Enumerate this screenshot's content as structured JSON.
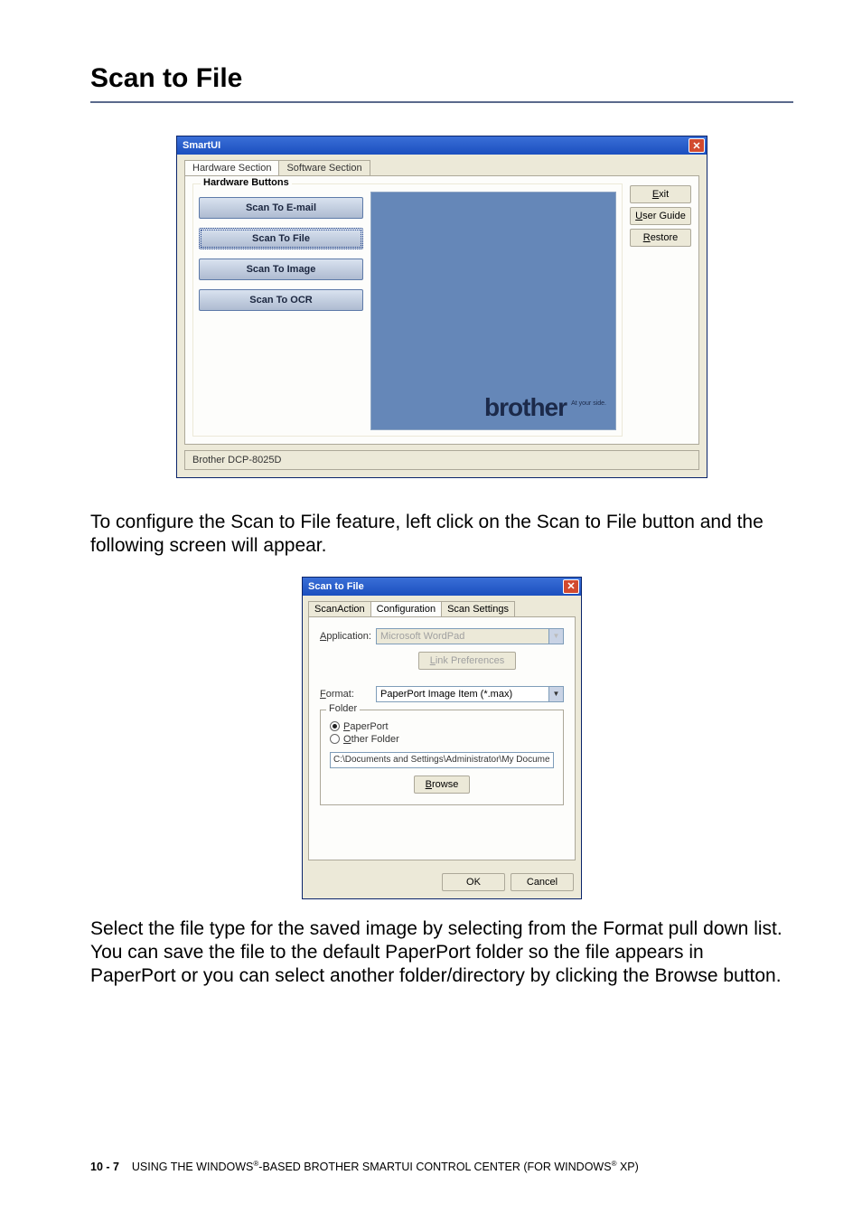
{
  "section_title": "Scan to File",
  "smartui": {
    "title": "SmartUI",
    "tabs": [
      "Hardware Section",
      "Software Section"
    ],
    "group_label": "Hardware Buttons",
    "buttons": [
      "Scan To E-mail",
      "Scan To File",
      "Scan To Image",
      "Scan To OCR"
    ],
    "side": {
      "exit": "Exit",
      "guide": "User Guide",
      "restore": "Restore"
    },
    "logo": "brother",
    "logo_tag": "At your side.",
    "status": "Brother DCP-8025D"
  },
  "para1": "To configure the Scan to File feature, left click on the Scan to File button and the following screen will appear.",
  "dialog": {
    "title": "Scan to File",
    "tabs": [
      "ScanAction",
      "Configuration",
      "Scan Settings"
    ],
    "application_label": "Application:",
    "application_value": "Microsoft WordPad",
    "link_pref": "Link Preferences",
    "format_label": "Format:",
    "format_value": "PaperPort Image Item (*.max)",
    "folder_label": "Folder",
    "radio_paperport": "PaperPort",
    "radio_other": "Other Folder",
    "path": "C:\\Documents and Settings\\Administrator\\My Documents\\M",
    "browse": "Browse",
    "ok": "OK",
    "cancel": "Cancel"
  },
  "para2": "Select the file type for the saved image by selecting from the Format pull down list. You can save the file to the default PaperPort folder so the file appears in PaperPort or you can select another folder/directory by clicking the Browse button.",
  "footer": {
    "page": "10 - 7",
    "text_a": "USING THE WINDOWS",
    "text_b": "-BASED BROTHER SMARTUI CONTROL CENTER (FOR WINDOWS",
    "text_c": " XP)",
    "reg": "®"
  }
}
